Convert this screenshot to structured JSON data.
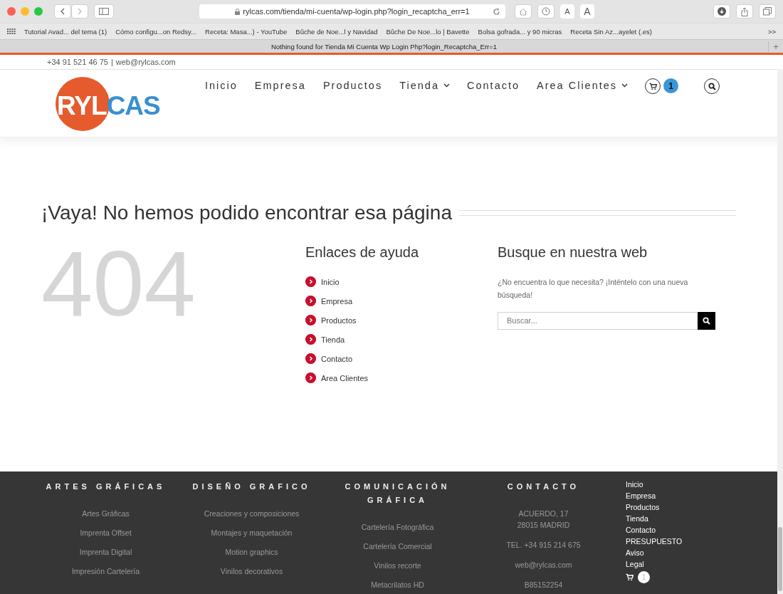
{
  "browser": {
    "url": "rylcas.com/tienda/mi-cuenta/wp-login.php?login_recaptcha_err=1",
    "font_buttons": [
      "A",
      "A"
    ],
    "bookmarks": [
      "Tutorial Avad... del tema (1)",
      "Cómo configu...on Redsy...",
      "Receta: Masa...) - YouTube",
      "Bûche de Noe...l y Navidad",
      "Bûche De Noe...lo | Bavette",
      "Bolsa gofrada... y 90 micras",
      "Receta Sin Az...ayelet (.es)"
    ],
    "more": ">>",
    "tab_title": "Nothing found for Tienda Mi Cuenta Wp Login Php?login_Recaptcha_Err=1",
    "new_tab": "+"
  },
  "topbar": {
    "phone": "+34 91 521 46 75",
    "separator": "|",
    "email": "web@rylcas.com"
  },
  "logo": {
    "part_1": "RYL",
    "part_2": "CAS"
  },
  "nav": [
    {
      "label": "Inicio",
      "dropdown": false
    },
    {
      "label": "Empresa",
      "dropdown": false
    },
    {
      "label": "Productos",
      "dropdown": false
    },
    {
      "label": "Tienda",
      "dropdown": true
    },
    {
      "label": "Contacto",
      "dropdown": false
    },
    {
      "label": "Area Clientes",
      "dropdown": true
    }
  ],
  "cart_count": "1",
  "heading": "¡Vaya! No hemos podido encontrar esa página",
  "error_code": "404",
  "help": {
    "title": "Enlaces de ayuda",
    "links": [
      "Inicio",
      "Empresa",
      "Productos",
      "Tienda",
      "Contacto",
      "Area Clientes"
    ]
  },
  "search": {
    "title": "Busque en nuestra web",
    "text": "¿No encuentra lo que necesita? ¡Inténtelo con una nueva búsqueda!",
    "placeholder": "Buscar..."
  },
  "footer": {
    "columns": [
      {
        "title": "ARTES GRÁFICAS",
        "items": [
          "Artes Gráficas",
          "Imprenta Offset",
          "Imprenta Digital",
          "Impresión Cartelería"
        ]
      },
      {
        "title": "DISEÑO GRAFICO",
        "items": [
          "Creaciones y composiciones",
          "Montajes y maquetación",
          "Motion graphics",
          "Vinilos decorativos"
        ]
      },
      {
        "title": "COMUNICACIÓN GRÁFICA",
        "items": [
          "Cartelería Fotográfica",
          "Cartelería Comercial",
          "Vinilos recorte",
          "Metacrilatos HD"
        ]
      },
      {
        "title": "CONTACTO",
        "items": [
          "ACUERDO, 17\n28015 MADRID",
          "TEL. +34 915 214 675",
          "web@rylcas.com",
          "B85152254"
        ]
      }
    ],
    "menu": [
      "Inicio",
      "Empresa",
      "Productos",
      "Tienda",
      "Contacto",
      "PRESUPUESTO",
      "Aviso",
      "Legal"
    ],
    "cart_count": "1"
  }
}
